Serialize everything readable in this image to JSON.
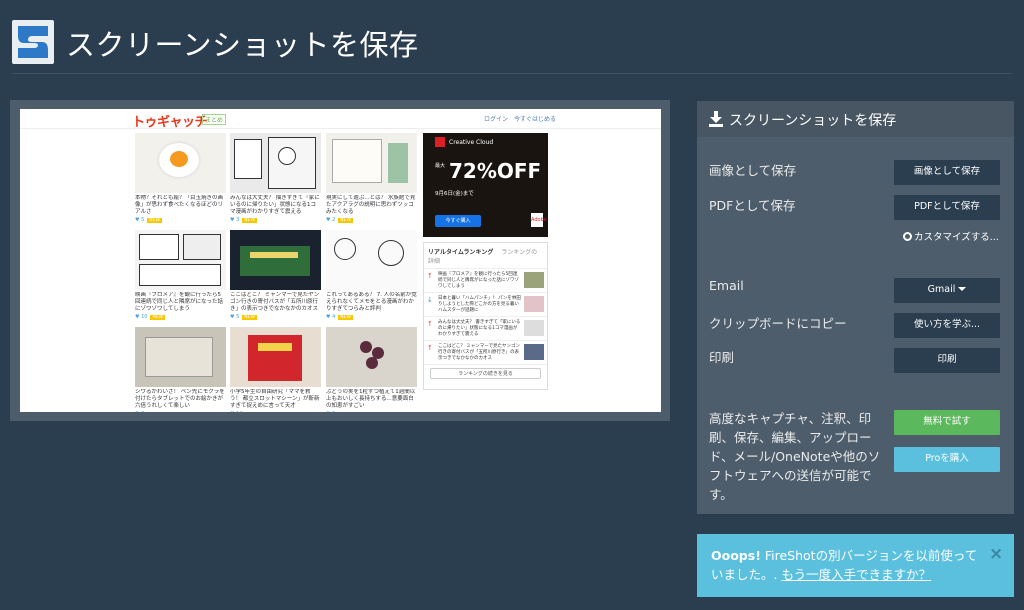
{
  "header": {
    "logo_letter": "S",
    "title": "スクリーンショットを保存"
  },
  "preview": {
    "site_brand": "トゥギャッチ",
    "site_badge": "まとめ",
    "site_login": "ログイン　今すぐはじめる",
    "tiles": [
      {
        "text": "本物？それとも絵？「目玉焼きの画像」が思わず食べたくなるほどのリアルさ",
        "meta": "5"
      },
      {
        "text": "みんなは大丈夫？ 描きすぎて「家にいるのに帰りたい」状態になる1コマ漫画がわかりすぎて震える",
        "meta": "3"
      },
      {
        "text": "現実にして遊ぶ...とは？ 水族館で見たアクアラグの説明に思わずツッコみたくなる",
        "meta": "2"
      },
      {
        "text": "映画『ブロメア』を観に行ったら5回連続で同じ人と隣席がになった話にゾワゾワしてしまう",
        "meta": "10"
      },
      {
        "text": "ここはどこ？ ミャンマーで見たヤンゴン行きの寄付バスが「五所川原行き」の表示つきでなかなかのカオス",
        "meta": "5"
      },
      {
        "text": "これってあるある？ 7. 人の名前が覚えられなくてメモをとる漫画がわかりすぎてつらみと評判",
        "meta": "4"
      },
      {
        "text": "シワるかわいさ！ ペン先にモクラを付けたらタブレットでのお絵かきが六倍うれしくて楽しい",
        "meta": "3"
      },
      {
        "text": "小学5年生の自由研究「ママを救う！ 都立スロットマシーン」が斬新すぎて捉えめに言って天才",
        "meta": "14"
      },
      {
        "text": "ぶどうの実を1粒ずつ植えて1週間以上もおいしく長持ちする...意要面白の知恵がすごい",
        "meta": "2"
      }
    ],
    "ad": {
      "brand": "Creative Cloud",
      "prefix": "最大",
      "big": "72%OFF",
      "date": "9月6日(金)まで",
      "cta": "今すぐ購入",
      "logo": "Adobe"
    },
    "ranking": {
      "title": "リアルタイムランキング",
      "sub": "ランキングの詳細",
      "items": [
        "映画『ブロメア』を観に行ったら5回連続で同じ人と隣席がになった話にゾワゾワしてしまう",
        "日本と暮い「ハムパンチ」！ パンを林田りしようとした際どこかの方を見る暮いハムスターが話題に",
        "みんなは大丈夫？ 書きすぎて「家にいるのに帰りたい」状態になる1コマ漫画がわかりすぎて震える",
        "ここはどこ？ ミャンマーで見たヤンゴン行きの寄付バスが「五所川原行き」の表示つきでなかなかのカオス"
      ],
      "more": "ランキングの続きを見る"
    }
  },
  "save_panel": {
    "title": "スクリーンショットを保存",
    "rows": [
      {
        "label": "画像として保存",
        "button": "画像として保存"
      },
      {
        "label": "PDFとして保存",
        "button": "PDFとして保存"
      },
      {
        "label": "Email",
        "button": "Gmail"
      },
      {
        "label": "クリップボードにコピー",
        "button": "使い方を学ぶ..."
      },
      {
        "label": "印刷",
        "button": "印刷"
      }
    ],
    "customize": "カスタマイズする...",
    "promo_text": "高度なキャプチャ、注釈、印刷、保存、編集、アップロード、メール/OneNoteや他のソフトウェアへの送信が可能です。",
    "trial_button": "無料で試す",
    "buy_button": "Proを購入"
  },
  "alert": {
    "bold": "Ooops!",
    "text": " FireShotの別バージョンを以前使っていました。. ",
    "link": "もう一度入手できますか？",
    "close": "×"
  },
  "colors": {
    "background": "#2b3e50",
    "panel": "#4e5d6c",
    "button_dark": "#2b3e50",
    "success": "#5cb85c",
    "info": "#5bc0de"
  }
}
